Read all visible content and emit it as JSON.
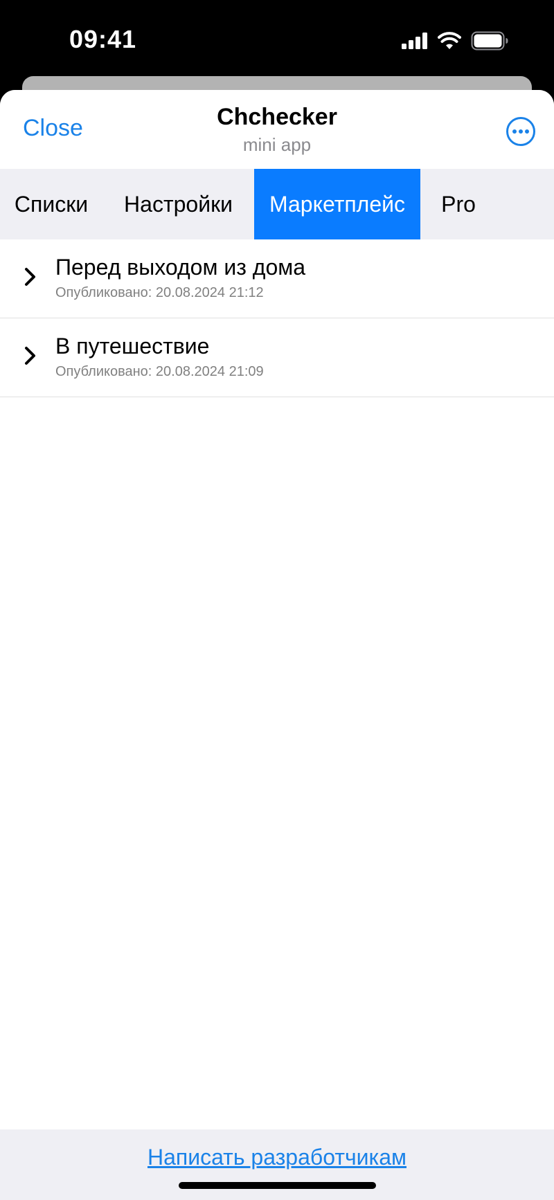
{
  "status_bar": {
    "time": "09:41"
  },
  "header": {
    "close_label": "Close",
    "title": "Chchecker",
    "subtitle": "mini app",
    "more_icon": "ellipsis-circle-icon"
  },
  "tabs": [
    {
      "label": "Списки",
      "active": false
    },
    {
      "label": "Настройки",
      "active": false
    },
    {
      "label": "Маркетплейс",
      "active": true
    },
    {
      "label": "Pro",
      "active": false
    }
  ],
  "items": [
    {
      "title": "Перед выходом из дома",
      "published": "Опубликовано: 20.08.2024 21:12",
      "icon": "chevron-right-icon"
    },
    {
      "title": "В путешествие",
      "published": "Опубликовано: 20.08.2024 21:09",
      "icon": "chevron-right-icon"
    }
  ],
  "footer": {
    "link_label": "Написать разработчикам"
  },
  "colors": {
    "accent": "#1a82e8",
    "active_tab": "#0a7cff",
    "tab_bar_bg": "#efeff4"
  }
}
